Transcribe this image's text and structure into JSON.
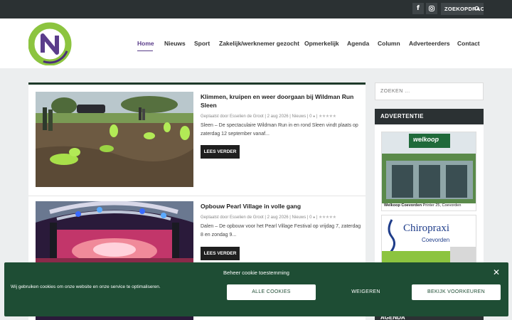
{
  "topbar": {
    "facebook_icon": "facebook-icon",
    "instagram_icon": "instagram-icon",
    "search_label": "ZOEKOPDRAC"
  },
  "header": {
    "logo_icon": "nn-logo",
    "nav": [
      "Home",
      "Nieuws",
      "Sport",
      "Zakelijk/werknemer gezocht",
      "Opmerkelijk",
      "Agenda",
      "Column",
      "Adverteerders",
      "Contact"
    ],
    "active": "Home",
    "accent": "#5a3d8a"
  },
  "articles": [
    {
      "title": "Klimmen, kruipen en weer doorgaan bij Wildman Run Sleen",
      "meta": "Geplaatst door Esselien de Groot | 2 aug 2026 | Nieuws | 0 ",
      "excerpt": "Sleen – De spectaculaire Wildman Run in en rond Sleen vindt plaats op zaterdag 12 september vanaf...",
      "button": "LEES VERDER"
    },
    {
      "title": "Opbouw Pearl Village in volle gang",
      "meta": "Geplaatst door Esselien de Groot | 2 aug 2026 | Nieuws | 0 ",
      "excerpt": "Dalen – De opbouw voor het Pearl Village Festival op vrijdag 7, zaterdag 8 en zondag 9...",
      "button": "LEES VERDER"
    }
  ],
  "sidebar": {
    "search_placeholder": "ZOEKEN ...",
    "ad_heading": "ADVERTENTIE",
    "ad1_brand": "welkoop",
    "ad1_caption_bold": "Welkoop Coevorden",
    "ad1_caption": "Printer 25, Coevorden",
    "ad2_brand": "Chiropraxi",
    "ad2_sub": "Coevorden",
    "agenda_heading": "AGENDA"
  },
  "cookie": {
    "title": "Beheer cookie toestemming",
    "text": "Wij gebruiken cookies om onze website en onze service te optimaliseren.",
    "accept": "ALLE COOKIES",
    "deny": "WEIGEREN",
    "prefs": "BEKIJK VOORKEUREN",
    "bg": "#1e4d34"
  }
}
